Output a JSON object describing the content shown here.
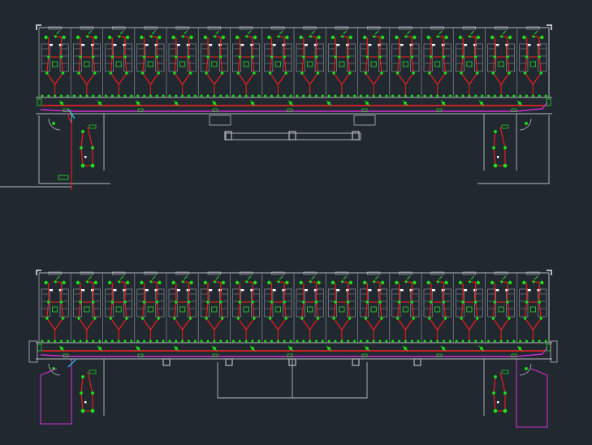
{
  "viewport": {
    "background": "#212830"
  },
  "drawing": {
    "colors": {
      "wall": "#b8bcc0",
      "wall_dark": "#7c8288",
      "fixture": "#9aa0a6",
      "circuit": "#ff1a1a",
      "bus": "#ff2020",
      "feeder": "#d02fd0",
      "device": "#22e022",
      "device_dark": "#0a8a0a",
      "accent": "#20d0ff",
      "label": "#ffffff"
    },
    "floors": [
      {
        "name": "upper-floor-plan",
        "has_stair_annex": true
      },
      {
        "name": "lower-floor-plan",
        "has_stair_annex": false
      }
    ],
    "rooms_per_floor": 16
  }
}
